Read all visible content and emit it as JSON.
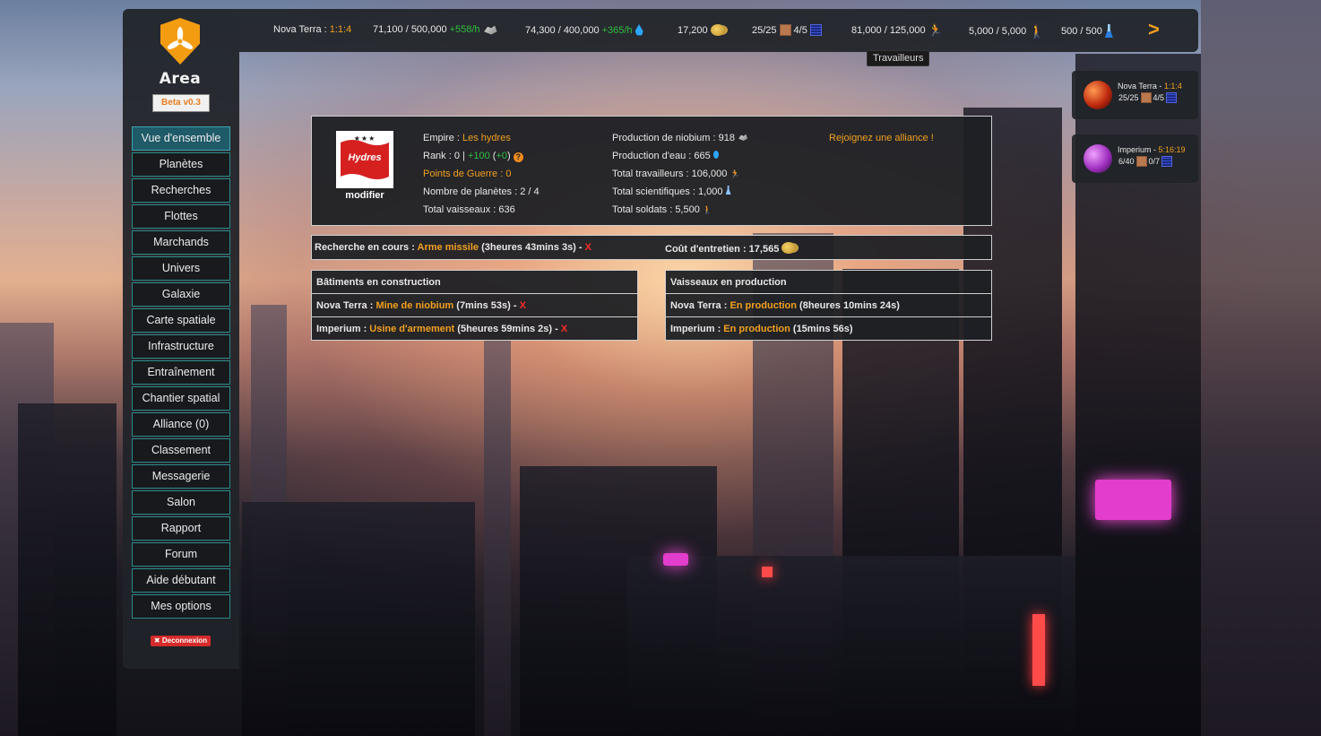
{
  "topbar": {
    "planet_label": "Nova Terra : ",
    "planet_ratio": "1:1:4",
    "niobium": "71,100 / 500,000",
    "niobium_rate": "+558/h",
    "water": "74,300 / 400,000",
    "water_rate": "+365/h",
    "money": "17,200",
    "ground": "25/25",
    "sky": "4/5",
    "workers": "81,000 / 125,000",
    "soldiers": "5,000 / 5,000",
    "scientists": "500 / 500",
    "next": ">"
  },
  "tooltip": "Travailleurs",
  "sidebar": {
    "logo_text": "Area",
    "beta": "Beta v0.3",
    "items": [
      "Vue d'ensemble",
      "Planètes",
      "Recherches",
      "Flottes",
      "Marchands",
      "Univers",
      "Galaxie",
      "Carte spatiale",
      "Infrastructure",
      "Entraînement",
      "Chantier spatial",
      "Alliance (0)",
      "Classement",
      "Messagerie",
      "Salon",
      "Rapport",
      "Forum",
      "Aide débutant",
      "Mes options"
    ],
    "logout": "✖ Deconnexion"
  },
  "empire": {
    "flag_stars": "★★★",
    "flag_text": "Hydres",
    "modifier": "modifier",
    "empire_label": "Empire : ",
    "empire_name": "Les hydres",
    "rank_label": "Rank : 0 | ",
    "rank_gain": "+100",
    "rank_gain_extra_open": " (",
    "rank_gain_extra": "+0",
    "rank_gain_extra_close": ") ",
    "war_points": "Points de Guerre : 0",
    "planets": "Nombre de planètes : 2 / 4",
    "ships": "Total vaisseaux : 636",
    "prod_niobium": "Production de niobium : 918",
    "prod_water": "Production d'eau : 665",
    "total_workers": "Total travailleurs : 106,000",
    "total_scientists": "Total scientifiques : 1,000",
    "total_soldiers": "Total soldats : 5,500",
    "alliance_link": "Rejoignez une alliance !"
  },
  "research": {
    "label": "Recherche en cours : ",
    "name": "Arme missile",
    "time": " (3heures 43mins 3s) - ",
    "cancel": "X",
    "upkeep_label": "Coût d'entretien : 17,565"
  },
  "buildings": {
    "title": "Bâtiments en construction",
    "rows": [
      {
        "planet": "Nova Terra : ",
        "name": "Mine de niobium",
        "time": " (7mins 53s) - ",
        "cancel": "X"
      },
      {
        "planet": "Imperium : ",
        "name": "Usine d'armement",
        "time": " (5heures 59mins 2s) - ",
        "cancel": "X"
      }
    ]
  },
  "ships_production": {
    "title": "Vaisseaux en production",
    "rows": [
      {
        "planet": "Nova Terra : ",
        "name": "En production",
        "time": " (8heures 10mins 24s)"
      },
      {
        "planet": "Imperium : ",
        "name": "En production",
        "time": " (15mins 56s)"
      }
    ]
  },
  "planets": [
    {
      "name": "Nova Terra - ",
      "info": "1:1:4",
      "ground": "25/25",
      "sky": "4/5"
    },
    {
      "name": "Imperium - ",
      "info": "5:16:19",
      "ground": "6/40",
      "sky": "0/7"
    }
  ],
  "colors": {
    "accent": "#f0a020",
    "positive": "#2fbf3f",
    "danger": "#ff2b2b",
    "nav_border": "#2c8a8c"
  }
}
